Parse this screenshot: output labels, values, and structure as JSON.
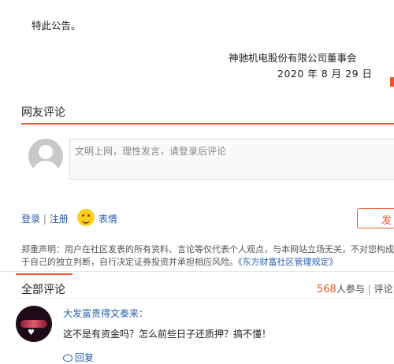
{
  "announcement": {
    "closing": "特此公告。",
    "company": "神驰机电股份有限公司董事会",
    "date": "2020 年 8 月 29 日"
  },
  "comment_section": {
    "title": "网友评论",
    "input_placeholder": "文明上网，理性发言，请登录后评论",
    "login": "登录",
    "separator": " | ",
    "register": "注册",
    "emoji_label": "表情",
    "post_button": "发",
    "disclaimer_line1": "郑重声明：用户在社区发表的所有资料、言论等仅代表个人观点，与本网站立场无关，不对您构成任何",
    "disclaimer_line2_prefix": "于自己的独立判断，自行决定证券投资并承担相应风险。",
    "disclaimer_link": "《东方财富社区管理规定》"
  },
  "all_comments": {
    "title": "全部评论",
    "participants_count": "568",
    "participants_label": "人参与",
    "divider": " | ",
    "comments_label": "评论"
  },
  "comments": [
    {
      "user": "大发富贵得文泰来：",
      "text": "这不是有资金吗？怎么前些日子还质押？搞不懂！",
      "reply_label": "回复"
    }
  ],
  "colors": {
    "accent": "#e8562a",
    "link": "#2a5ea8"
  }
}
